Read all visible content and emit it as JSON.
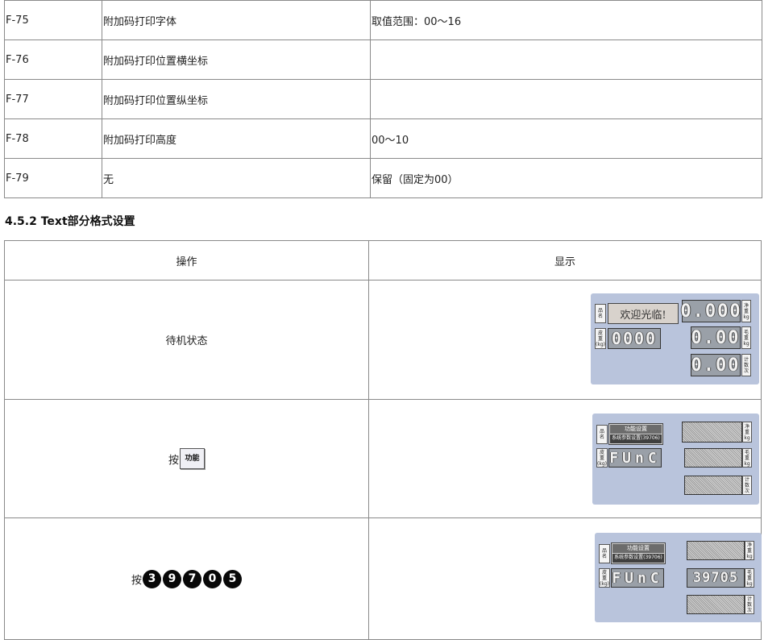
{
  "param_table": {
    "rows": [
      {
        "code": "F-75",
        "name": "附加码打印字体",
        "note": "取值范围：00～16"
      },
      {
        "code": "F-76",
        "name": "附加码打印位置横坐标",
        "note": ""
      },
      {
        "code": "F-77",
        "name": "附加码打印位置纵坐标",
        "note": ""
      },
      {
        "code": "F-78",
        "name": "附加码打印高度",
        "note": "00～10"
      },
      {
        "code": "F-79",
        "name": "无",
        "note": "保留（固定为00）"
      }
    ]
  },
  "section": {
    "heading": "4.5.2 Text部分格式设置"
  },
  "op_table": {
    "headers": {
      "operation": "操作",
      "display": "显示"
    },
    "rows": [
      {
        "operation": "待机状态"
      },
      {
        "operation_prefix": "按",
        "key_label": "功能"
      },
      {
        "operation_prefix": "按",
        "keys": [
          "3",
          "9",
          "7",
          "0",
          "5"
        ]
      }
    ]
  },
  "displays": {
    "labels": {
      "name": [
        "品",
        "名"
      ],
      "tare": [
        "皮",
        "重",
        "(kg)"
      ],
      "net": [
        "净",
        "重",
        "kg"
      ],
      "gross": [
        "毛",
        "重",
        "kg"
      ],
      "count": [
        "计",
        "数",
        "次"
      ]
    },
    "standby": {
      "welcome": "欢迎光临!",
      "tare": "0000",
      "net": "0.000",
      "gross": "0.00",
      "count": "0.00"
    },
    "func": {
      "title": "功能设置",
      "subtitle": "系统参数设置(39706)",
      "code": "FUnC"
    },
    "func_entered": {
      "title": "功能设置",
      "subtitle": "系统参数设置(39706)",
      "code": "FUnC",
      "value": "39705"
    }
  }
}
